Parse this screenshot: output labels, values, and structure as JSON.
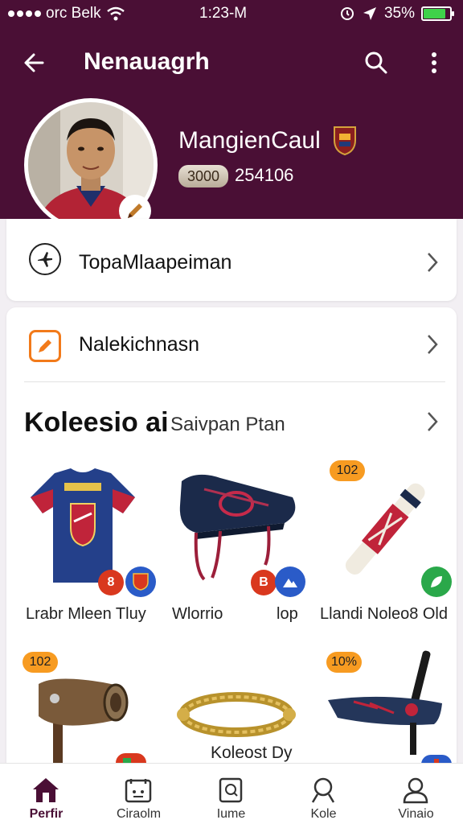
{
  "status_bar": {
    "carrier": "orc Belk",
    "time": "1:23-M",
    "battery": "35%",
    "battery_level": 0.85
  },
  "appbar": {
    "title": "Nenauagrh"
  },
  "profile": {
    "name": "MangienCaul",
    "points_pill": "3000",
    "points_value": "254106"
  },
  "menu": {
    "row1": {
      "label": "TopaMlaapeiman",
      "icon": "plane-icon"
    },
    "row2": {
      "label": "Nalekichnasn",
      "icon": "edit-icon"
    }
  },
  "collection": {
    "title": "Koleesio ai",
    "subtitle": "Saivpan Ptan",
    "items": [
      {
        "label": "Lrabr Mleen Tluy",
        "tag": "",
        "chip1": "8",
        "icon": "jersey-icon"
      },
      {
        "label": "Wlorrio",
        "label2": "lop",
        "tag": "",
        "chip1": "B",
        "icon": "boot-icon"
      },
      {
        "label": "Llandi Noleo8 Old",
        "tag": "102",
        "icon": "bat-icon"
      },
      {
        "label": "",
        "tag": "102",
        "icon": "stick-icon"
      },
      {
        "label": "Koleost Dy",
        "tag": "",
        "icon": "bracelet-icon"
      },
      {
        "label": "",
        "tag": "10%",
        "icon": "skateboard-icon"
      }
    ]
  },
  "bottom_nav": [
    {
      "label": "Perfir",
      "icon": "home-icon",
      "active": true
    },
    {
      "label": "Ciraolm",
      "icon": "calendar-icon",
      "active": false
    },
    {
      "label": "Iume",
      "icon": "document-icon",
      "active": false
    },
    {
      "label": "Kole",
      "icon": "search-icon",
      "active": false
    },
    {
      "label": "Vinaio",
      "icon": "person-icon",
      "active": false
    }
  ],
  "colors": {
    "brand": "#4a0f35",
    "accent": "#f79b21",
    "battery": "#3fd24a"
  }
}
